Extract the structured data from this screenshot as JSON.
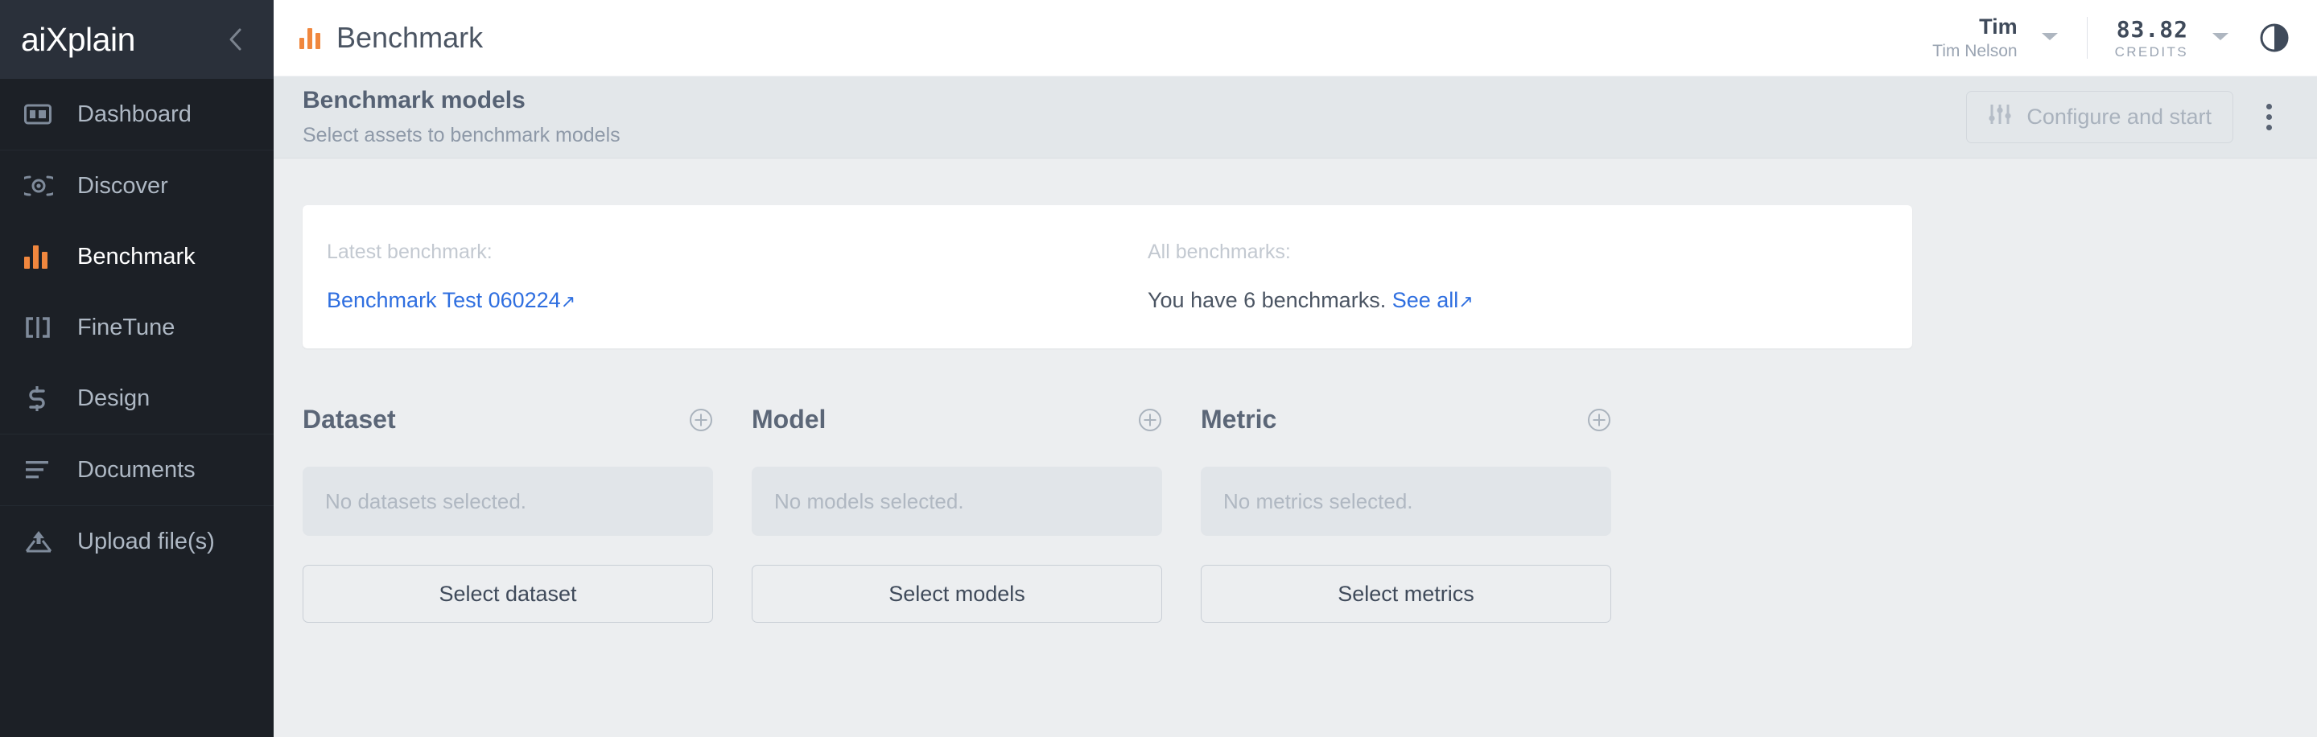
{
  "sidebar": {
    "logo": "aiXplain",
    "collapse_icon": "chevron-left-icon",
    "items": [
      {
        "label": "Dashboard",
        "icon": "layout-panel-icon",
        "active": false
      },
      {
        "label": "Discover",
        "icon": "radar-circle-icon",
        "active": false
      },
      {
        "label": "Benchmark",
        "icon": "bar-chart-icon",
        "active": true
      },
      {
        "label": "FineTune",
        "icon": "tune-brackets-icon",
        "active": false
      },
      {
        "label": "Design",
        "icon": "flow-s-icon",
        "active": false
      },
      {
        "label": "Documents",
        "icon": "lines-icon",
        "active": false
      },
      {
        "label": "Upload file(s)",
        "icon": "upload-icon",
        "active": false
      }
    ]
  },
  "topbar": {
    "title": "Benchmark",
    "title_icon": "bar-chart-icon",
    "user": {
      "short_name": "Tim",
      "full_name": "Tim Nelson",
      "caret_icon": "chevron-down-icon"
    },
    "credits": {
      "amount": "83.82",
      "label": "CREDITS",
      "caret_icon": "chevron-down-icon"
    },
    "theme_toggle_icon": "contrast-half-circle-icon"
  },
  "subheader": {
    "title": "Benchmark models",
    "subtitle": "Select assets to benchmark models",
    "configure_button": {
      "label": "Configure and start",
      "icon": "sliders-icon",
      "disabled": true
    },
    "kebab_icon": "more-vertical-icon"
  },
  "info_card": {
    "latest": {
      "label": "Latest benchmark:",
      "link_text": "Benchmark Test 060224",
      "link_icon": "external-link-arrow-icon"
    },
    "all": {
      "label": "All benchmarks:",
      "text": "You have 6 benchmarks.",
      "link_text": "See all",
      "link_icon": "external-link-arrow-icon"
    }
  },
  "columns": [
    {
      "title": "Dataset",
      "add_icon": "circle-plus-icon",
      "empty_text": "No datasets selected.",
      "button_label": "Select dataset"
    },
    {
      "title": "Model",
      "add_icon": "circle-plus-icon",
      "empty_text": "No models selected.",
      "button_label": "Select models"
    },
    {
      "title": "Metric",
      "add_icon": "circle-plus-icon",
      "empty_text": "No metrics selected.",
      "button_label": "Select metrics"
    }
  ],
  "colors": {
    "accent": "#f0873e",
    "link": "#2f6fe0",
    "sidebar_bg": "#1c2026",
    "sidebar_header_bg": "#2a303a",
    "subheader_bg": "#e3e7ea",
    "page_bg": "#eceef0"
  }
}
